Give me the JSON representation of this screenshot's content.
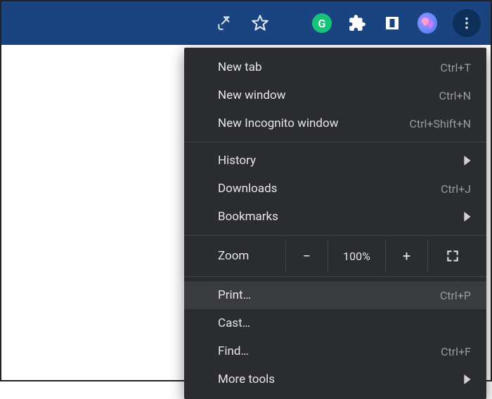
{
  "toolbar": {
    "icons": {
      "share": "share-icon",
      "star": "star-icon",
      "grammarly_letter": "G",
      "extensions": "puzzle-icon",
      "reader": "reader-mode-icon",
      "more": "more-vert-icon"
    }
  },
  "menu": {
    "new_tab": {
      "label": "New tab",
      "shortcut": "Ctrl+T"
    },
    "new_window": {
      "label": "New window",
      "shortcut": "Ctrl+N"
    },
    "incognito": {
      "label": "New Incognito window",
      "shortcut": "Ctrl+Shift+N"
    },
    "history": {
      "label": "History"
    },
    "downloads": {
      "label": "Downloads",
      "shortcut": "Ctrl+J"
    },
    "bookmarks": {
      "label": "Bookmarks"
    },
    "zoom": {
      "label": "Zoom",
      "value": "100%"
    },
    "print": {
      "label": "Print…",
      "shortcut": "Ctrl+P"
    },
    "cast": {
      "label": "Cast…"
    },
    "find": {
      "label": "Find…",
      "shortcut": "Ctrl+F"
    },
    "more_tools": {
      "label": "More tools"
    }
  }
}
